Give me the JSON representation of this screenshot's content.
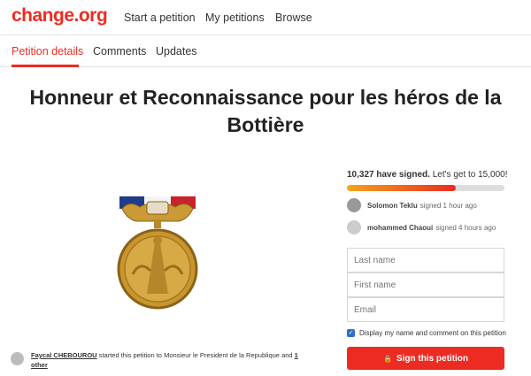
{
  "header": {
    "logo": "change.org",
    "nav": [
      "Start a petition",
      "My petitions",
      "Browse"
    ]
  },
  "tabs": [
    "Petition details",
    "Comments",
    "Updates"
  ],
  "petition": {
    "title_line1": "Honneur et Reconnaissance pour les héros de la",
    "title_line2": "Bottière"
  },
  "progress": {
    "signed_count": "10,327 have signed.",
    "goal_text": " Let's get to 15,000!",
    "fraction": 0.69
  },
  "signers": [
    {
      "name": "Solomon Teklu",
      "action": "signed 1 hour ago"
    },
    {
      "name": "mohammed Chaoui",
      "action": "signed 4 hours ago"
    }
  ],
  "form": {
    "last_name_placeholder": "Last name",
    "first_name_placeholder": "First name",
    "email_placeholder": "Email",
    "display_checkbox_label": "Display my name and comment on this petition",
    "sign_button": "Sign this petition"
  },
  "starter": {
    "name": "Faycal CHEBOUROU",
    "text": " started this petition to Monsieur le President de la Republique and ",
    "others": "1 other"
  },
  "colors": {
    "brand": "#ec2c22",
    "checkbox": "#2b70c9"
  }
}
